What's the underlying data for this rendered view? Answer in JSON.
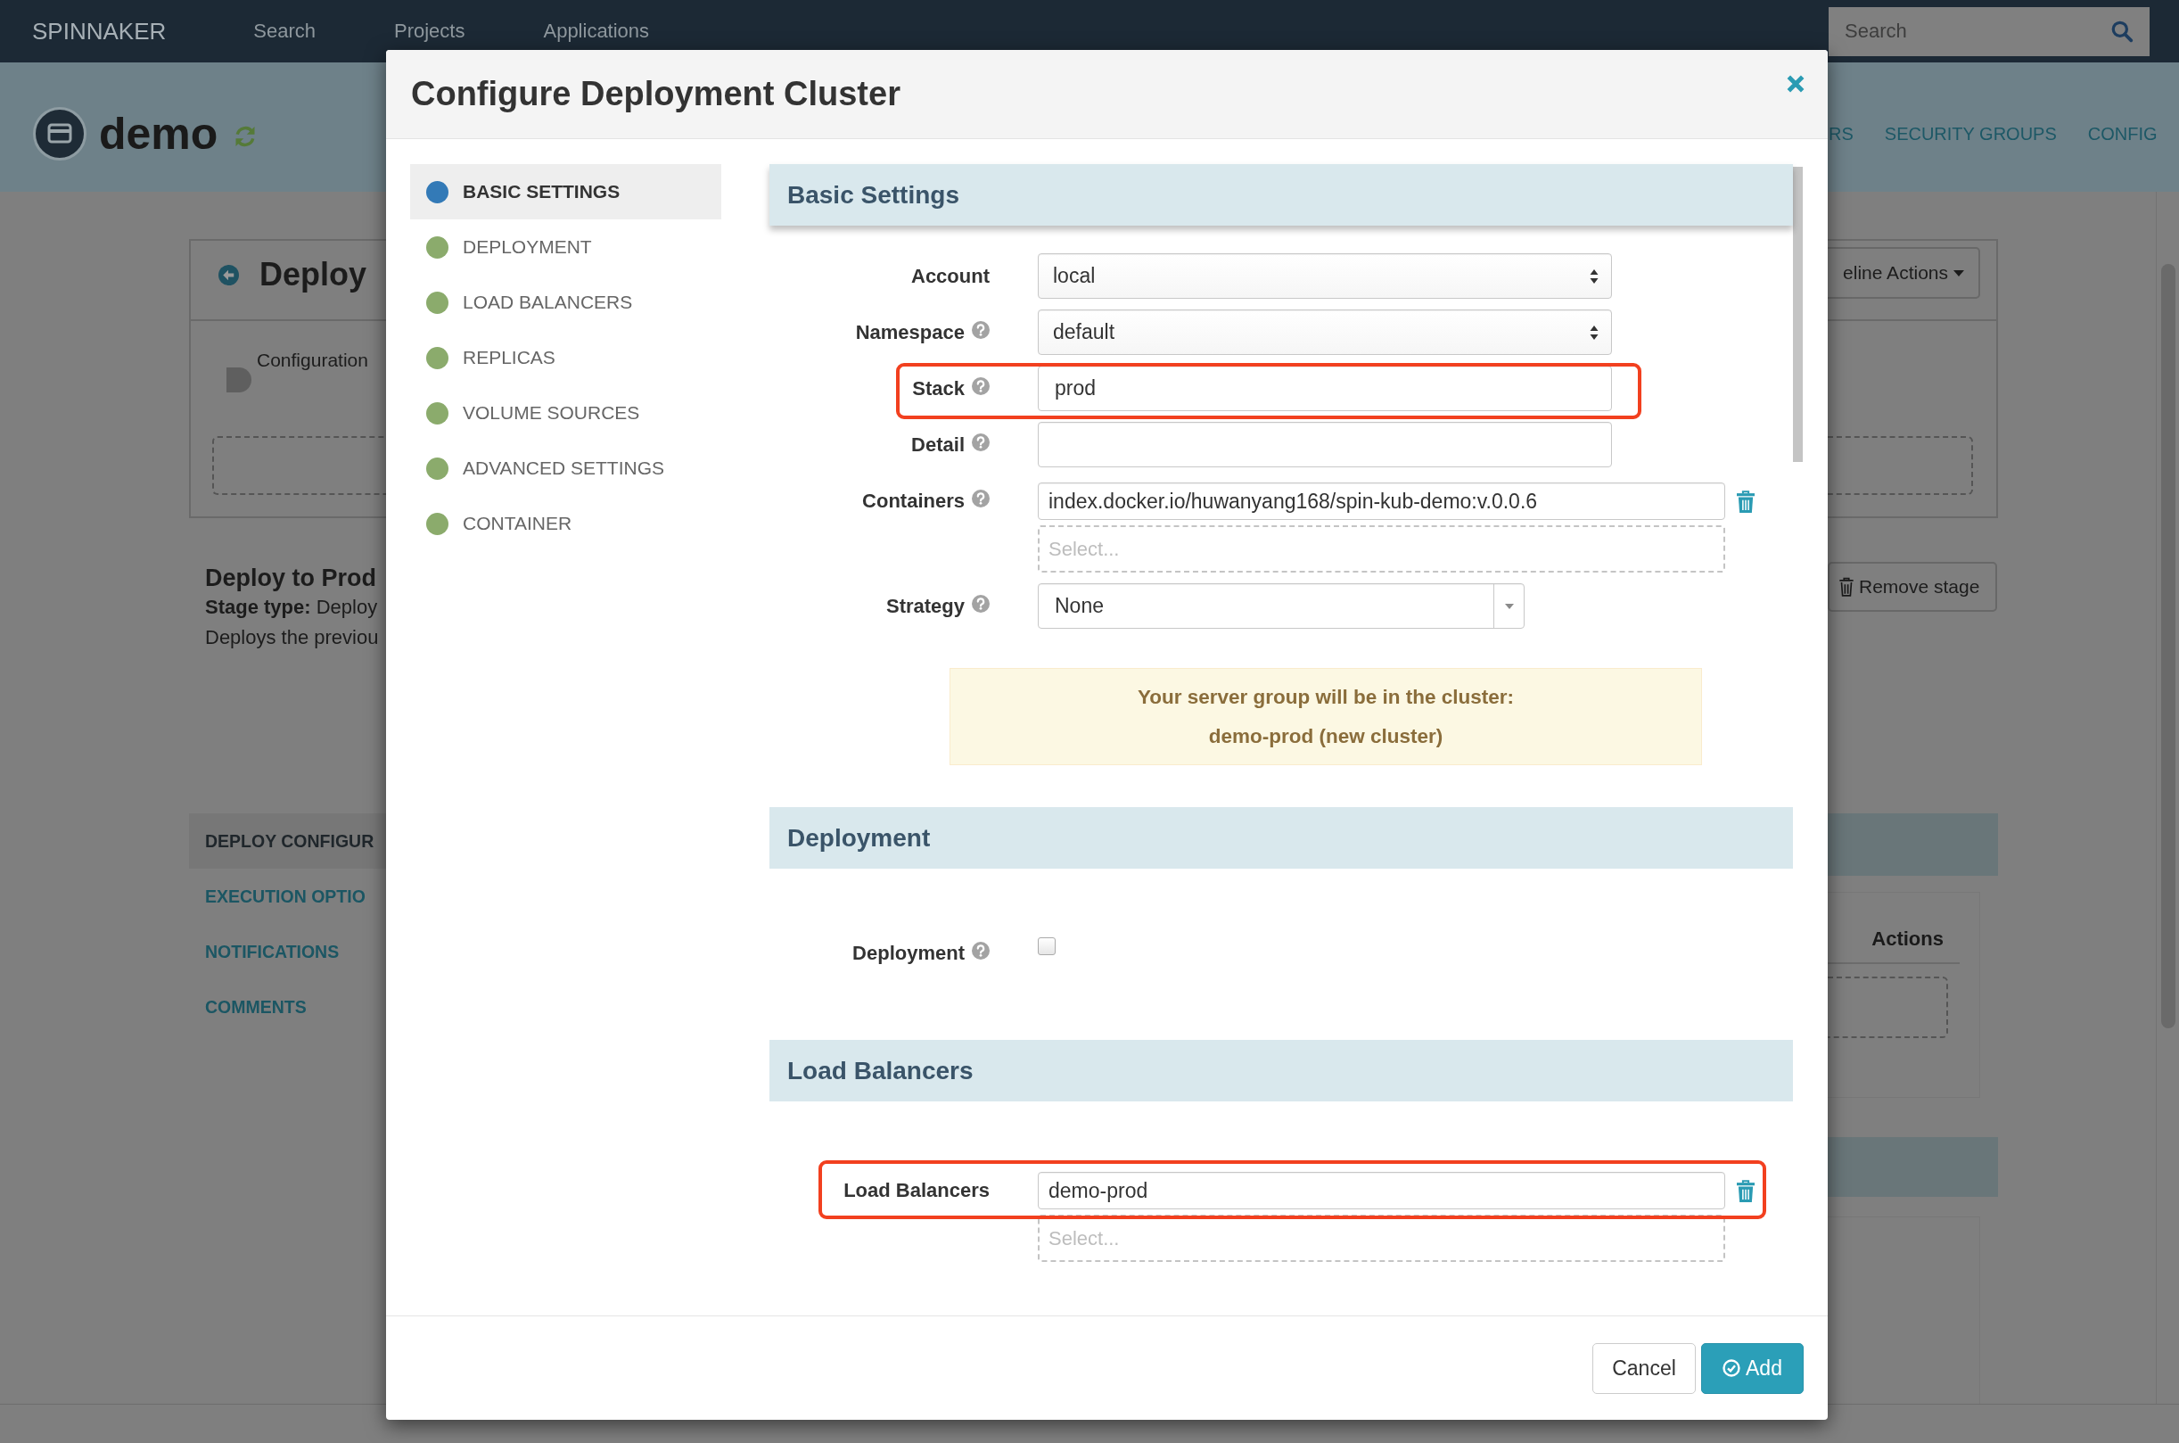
{
  "top_nav": {
    "brand": "SPINNAKER",
    "links": [
      "Search",
      "Projects",
      "Applications"
    ],
    "search": {
      "placeholder": "Search"
    }
  },
  "app_header": {
    "name": "demo",
    "tabs": [
      "RS",
      "SECURITY GROUPS",
      "CONFIG"
    ]
  },
  "pipeline_editor": {
    "stage_heading": "Deploy",
    "stage_node": "Configuration",
    "pipeline_actions": "eline Actions",
    "stage_name": "Deploy to Prod",
    "stage_type": "**Stage type:** Deploy",
    "description": "Deploys the previou",
    "remove_stage": "Remove stage",
    "nav": [
      {
        "label": "DEPLOY CONFIGUR",
        "selected": true
      },
      {
        "label": "EXECUTION OPTIO",
        "selected": false
      },
      {
        "label": "NOTIFICATIONS",
        "selected": false
      },
      {
        "label": "COMMENTS",
        "selected": false
      }
    ],
    "table": {
      "columns": [
        "Actions"
      ]
    }
  },
  "dialog": {
    "title": "Configure Deployment Cluster",
    "nav": [
      {
        "label": "BASIC SETTINGS",
        "selected": true,
        "color": "#337ab7"
      },
      {
        "label": "DEPLOYMENT",
        "selected": false,
        "color": "#8bab6c"
      },
      {
        "label": "LOAD BALANCERS",
        "selected": false,
        "color": "#8bab6c"
      },
      {
        "label": "REPLICAS",
        "selected": false,
        "color": "#8bab6c"
      },
      {
        "label": "VOLUME SOURCES",
        "selected": false,
        "color": "#8bab6c"
      },
      {
        "label": "ADVANCED SETTINGS",
        "selected": false,
        "color": "#8bab6c"
      },
      {
        "label": "CONTAINER",
        "selected": false,
        "color": "#8bab6c"
      }
    ],
    "sections": [
      {
        "heading": "Basic Settings",
        "pinned": true,
        "fields": [
          {
            "kind": "select",
            "label": "Account",
            "help": false,
            "highlighted": false,
            "value": "local"
          },
          {
            "kind": "select",
            "label": "Namespace",
            "help": true,
            "highlighted": false,
            "value": "default"
          },
          {
            "kind": "text",
            "label": "Stack",
            "help": true,
            "highlighted": true,
            "value": "prod"
          },
          {
            "kind": "text",
            "label": "Detail",
            "help": true,
            "highlighted": false
          },
          {
            "kind": "multi",
            "label": "Containers",
            "help": true,
            "highlighted": false,
            "values": [
              "index.docker.io/huwanyang168/spin-kub-demo:v.0.0.6"
            ],
            "placeholder": "Select..."
          },
          {
            "kind": "dropdown",
            "label": "Strategy",
            "help": true,
            "highlighted": false,
            "value": "None"
          }
        ],
        "notice": [
          "Your server group will be in the cluster:",
          "demo-prod (new cluster)"
        ]
      },
      {
        "heading": "Deployment",
        "pinned": false,
        "fields": [
          {
            "kind": "checkbox",
            "label": "Deployment",
            "help": true,
            "highlighted": false,
            "checked": false
          }
        ]
      },
      {
        "heading": "Load Balancers",
        "pinned": false,
        "fields": [
          {
            "kind": "multi",
            "label": "Load Balancers",
            "help": false,
            "highlighted": true,
            "values": [
              "demo-prod"
            ],
            "placeholder": "Select..."
          }
        ]
      }
    ],
    "buttons": [
      {
        "kind": "cancel",
        "label": "Cancel"
      },
      {
        "kind": "confirm",
        "label": "Add"
      }
    ]
  }
}
